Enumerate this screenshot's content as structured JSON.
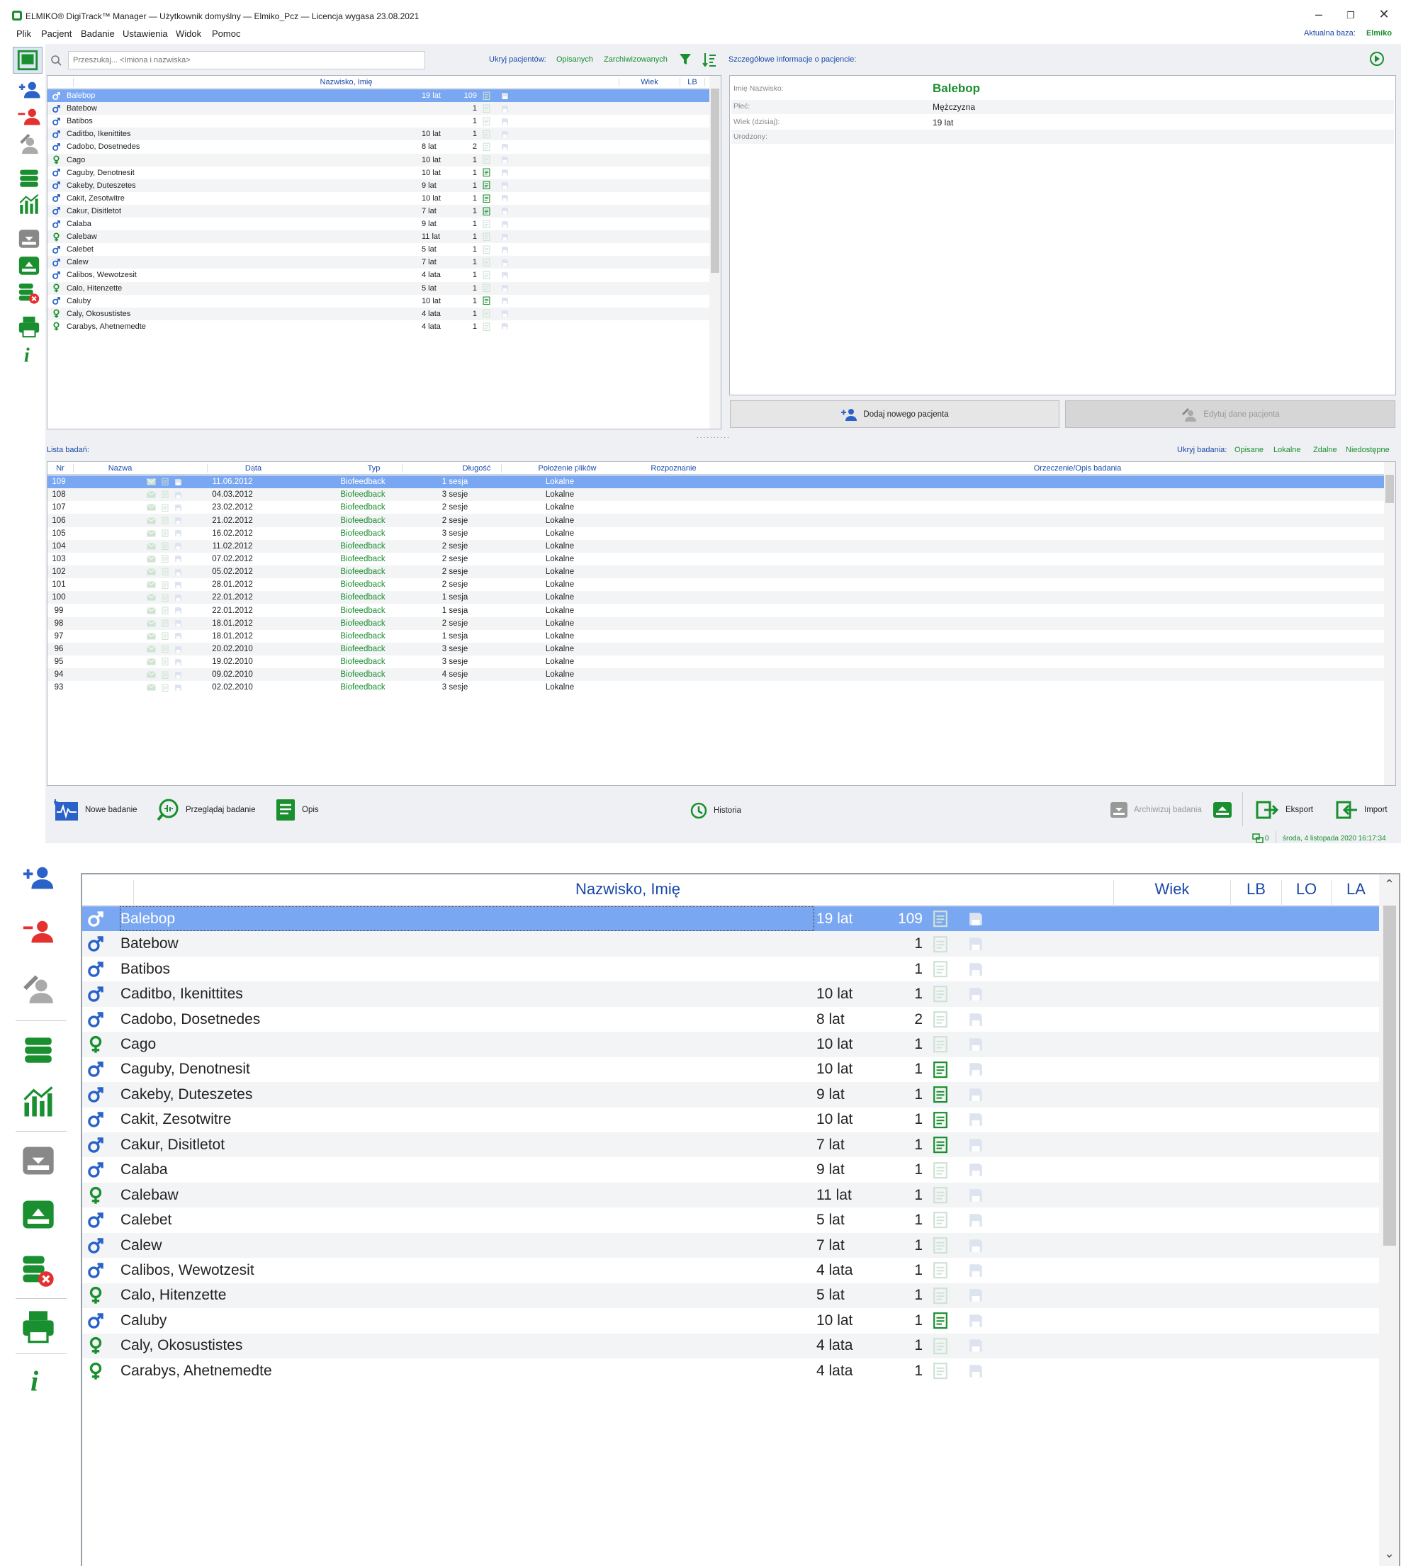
{
  "app": {
    "title": "ELMIKO® DigiTrack™ Manager — Użytkownik domyślny — Elmiko_Pcz — Licencja wygasa 23.08.2021",
    "menu": [
      "Plik",
      "Pacjent",
      "Badanie",
      "Ustawienia",
      "Widok",
      "Pomoc"
    ],
    "db_label": "Aktualna baza:",
    "db_value": "Elmiko",
    "minimize": "–",
    "restore": "❐",
    "close": "✕"
  },
  "search": {
    "placeholder": "Przeszukaj... <Imiona i nazwiska>"
  },
  "patient_filter": {
    "label": "Ukryj pacjentów:",
    "opt1": "Opisanych",
    "opt2": "Zarchiwizowanych"
  },
  "details": {
    "title": "Szczegółowe informacje o pacjencie:",
    "name_label": "Imię Nazwisko:",
    "name_value": "Balebop",
    "sex_label": "Płeć:",
    "sex_value": "Mężczyzna",
    "age_label": "Wiek (dzisiaj):",
    "age_value": "19 lat",
    "born_label": "Urodzony:",
    "born_value": ""
  },
  "patient_table": {
    "headers": {
      "name": "Nazwisko, Imię",
      "age": "Wiek",
      "lb": "LB",
      "lo": "LO",
      "la": "LA"
    },
    "rows": [
      {
        "sex": "m",
        "name": "Balebop",
        "age": "19 lat",
        "lb": "109",
        "lo": "off",
        "selected": true
      },
      {
        "sex": "m",
        "name": "Batebow",
        "age": "",
        "lb": "1",
        "lo": "off"
      },
      {
        "sex": "m",
        "name": "Batibos",
        "age": "",
        "lb": "1",
        "lo": "off"
      },
      {
        "sex": "m",
        "name": "Caditbo, Ikenittites",
        "age": "10 lat",
        "lb": "1",
        "lo": "off"
      },
      {
        "sex": "m",
        "name": "Cadobo, Dosetnedes",
        "age": "8 lat",
        "lb": "2",
        "lo": "off"
      },
      {
        "sex": "f",
        "name": "Cago",
        "age": "10 lat",
        "lb": "1",
        "lo": "off"
      },
      {
        "sex": "m",
        "name": "Caguby, Denotnesit",
        "age": "10 lat",
        "lb": "1",
        "lo": "on"
      },
      {
        "sex": "m",
        "name": "Cakeby, Duteszetes",
        "age": "9 lat",
        "lb": "1",
        "lo": "on"
      },
      {
        "sex": "m",
        "name": "Cakit, Zesotwitre",
        "age": "10 lat",
        "lb": "1",
        "lo": "on"
      },
      {
        "sex": "m",
        "name": "Cakur, Disitletot",
        "age": "7 lat",
        "lb": "1",
        "lo": "on"
      },
      {
        "sex": "m",
        "name": "Calaba",
        "age": "9 lat",
        "lb": "1",
        "lo": "off"
      },
      {
        "sex": "f",
        "name": "Calebaw",
        "age": "11 lat",
        "lb": "1",
        "lo": "off"
      },
      {
        "sex": "m",
        "name": "Calebet",
        "age": "5 lat",
        "lb": "1",
        "lo": "off"
      },
      {
        "sex": "m",
        "name": "Calew",
        "age": "7 lat",
        "lb": "1",
        "lo": "off"
      },
      {
        "sex": "m",
        "name": "Calibos, Wewotzesit",
        "age": "4 lata",
        "lb": "1",
        "lo": "off"
      },
      {
        "sex": "f",
        "name": "Calo, Hitenzette",
        "age": "5 lat",
        "lb": "1",
        "lo": "off"
      },
      {
        "sex": "m",
        "name": "Caluby",
        "age": "10 lat",
        "lb": "1",
        "lo": "on"
      },
      {
        "sex": "f",
        "name": "Caly, Okosustistes",
        "age": "4 lata",
        "lb": "1",
        "lo": "off"
      },
      {
        "sex": "f",
        "name": "Carabys, Ahetnemedte",
        "age": "4 lata",
        "lb": "1",
        "lo": "off"
      }
    ]
  },
  "patient_buttons": {
    "add": "Dodaj nowego pacjenta",
    "edit": "Edytuj dane pacjenta"
  },
  "exams": {
    "title": "Lista badań:",
    "filter": {
      "label": "Ukryj badania:",
      "opts": [
        "Opisane",
        "Lokalne",
        "Zdalne",
        "Niedostępne"
      ]
    },
    "headers": {
      "nr": "Nr",
      "name": "Nazwa",
      "date": "Data",
      "type": "Typ",
      "len": "Długość",
      "loc": "Położenie plików",
      "diag": "Rozpoznanie",
      "desc": "Orzeczenie/Opis badania"
    },
    "rows": [
      {
        "nr": "109",
        "date": "11.06.2012",
        "type": "Biofeedback",
        "len": "1 sesja",
        "loc": "Lokalne",
        "selected": true
      },
      {
        "nr": "108",
        "date": "04.03.2012",
        "type": "Biofeedback",
        "len": "3 sesje",
        "loc": "Lokalne"
      },
      {
        "nr": "107",
        "date": "23.02.2012",
        "type": "Biofeedback",
        "len": "2 sesje",
        "loc": "Lokalne"
      },
      {
        "nr": "106",
        "date": "21.02.2012",
        "type": "Biofeedback",
        "len": "2 sesje",
        "loc": "Lokalne"
      },
      {
        "nr": "105",
        "date": "16.02.2012",
        "type": "Biofeedback",
        "len": "3 sesje",
        "loc": "Lokalne"
      },
      {
        "nr": "104",
        "date": "11.02.2012",
        "type": "Biofeedback",
        "len": "2 sesje",
        "loc": "Lokalne"
      },
      {
        "nr": "103",
        "date": "07.02.2012",
        "type": "Biofeedback",
        "len": "2 sesje",
        "loc": "Lokalne"
      },
      {
        "nr": "102",
        "date": "05.02.2012",
        "type": "Biofeedback",
        "len": "2 sesje",
        "loc": "Lokalne"
      },
      {
        "nr": "101",
        "date": "28.01.2012",
        "type": "Biofeedback",
        "len": "2 sesje",
        "loc": "Lokalne"
      },
      {
        "nr": "100",
        "date": "22.01.2012",
        "type": "Biofeedback",
        "len": "1 sesja",
        "loc": "Lokalne"
      },
      {
        "nr": "99",
        "date": "22.01.2012",
        "type": "Biofeedback",
        "len": "1 sesja",
        "loc": "Lokalne"
      },
      {
        "nr": "98",
        "date": "18.01.2012",
        "type": "Biofeedback",
        "len": "2 sesje",
        "loc": "Lokalne"
      },
      {
        "nr": "97",
        "date": "18.01.2012",
        "type": "Biofeedback",
        "len": "1 sesja",
        "loc": "Lokalne"
      },
      {
        "nr": "96",
        "date": "20.02.2010",
        "type": "Biofeedback",
        "len": "3 sesje",
        "loc": "Lokalne"
      },
      {
        "nr": "95",
        "date": "19.02.2010",
        "type": "Biofeedback",
        "len": "3 sesje",
        "loc": "Lokalne"
      },
      {
        "nr": "94",
        "date": "09.02.2010",
        "type": "Biofeedback",
        "len": "4 sesje",
        "loc": "Lokalne"
      },
      {
        "nr": "93",
        "date": "02.02.2010",
        "type": "Biofeedback",
        "len": "3 sesje",
        "loc": "Lokalne"
      }
    ]
  },
  "toolbar": {
    "new": "Nowe badanie",
    "browse": "Przeglądaj badanie",
    "desc": "Opis",
    "history": "Historia",
    "archive": "Archiwizuj badania",
    "export": "Eksport",
    "import": "Import"
  },
  "status": {
    "count": "0",
    "datetime": "środa, 4 listopada 2020 16:17:34"
  },
  "colors": {
    "green": "#1a8f2f",
    "blue": "#1a4aa8",
    "selection": "#7aa7f2",
    "male": "#2a62c9",
    "female": "#1a8f2f"
  }
}
